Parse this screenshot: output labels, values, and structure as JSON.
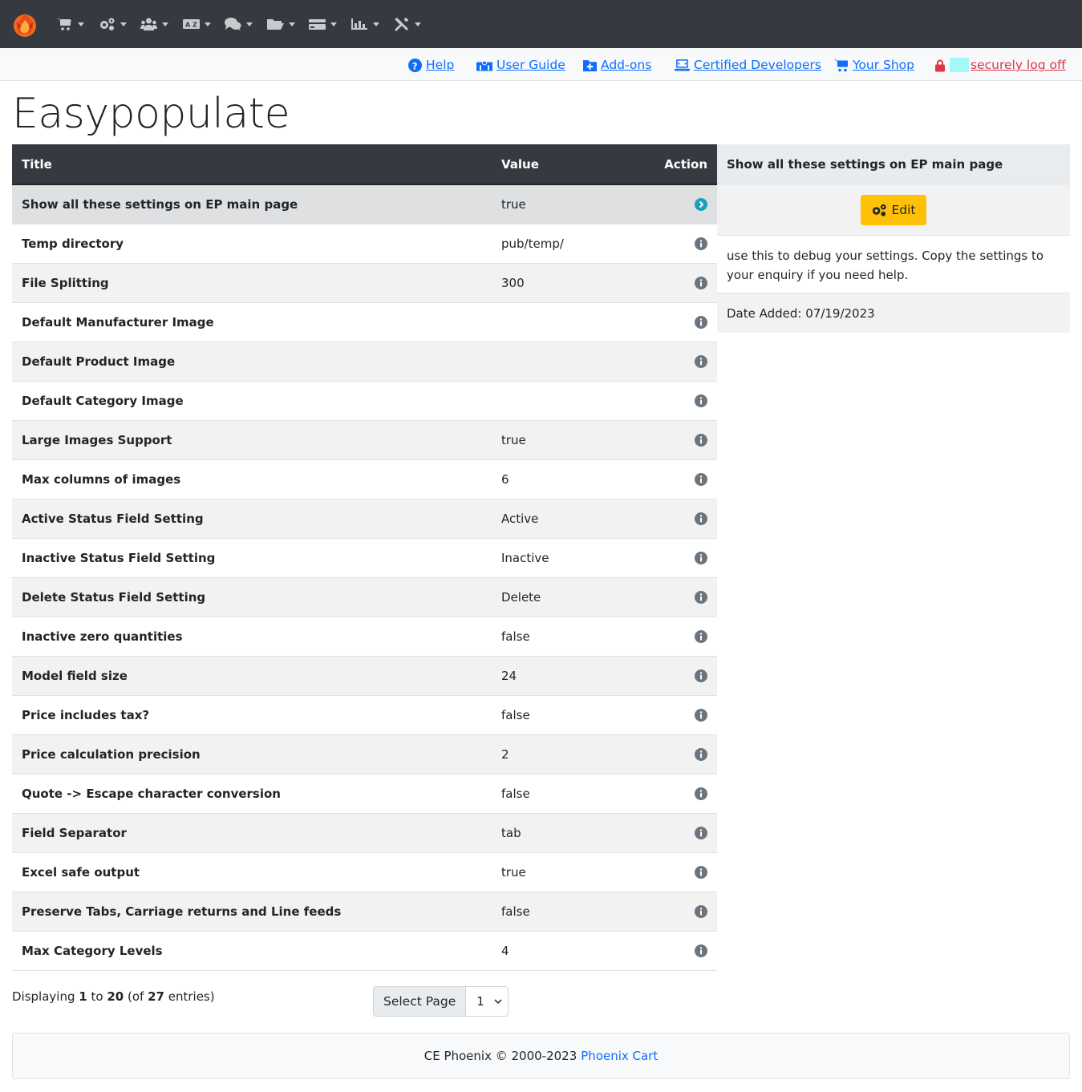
{
  "navbar": {
    "menus": [
      {
        "icon": "cart-icon"
      },
      {
        "icon": "cogs-icon"
      },
      {
        "icon": "users-icon"
      },
      {
        "icon": "language-icon"
      },
      {
        "icon": "comments-icon"
      },
      {
        "icon": "folder-icon"
      },
      {
        "icon": "payment-icon"
      },
      {
        "icon": "chart-icon"
      },
      {
        "icon": "tools-icon"
      }
    ]
  },
  "links": {
    "help": "Help",
    "user_guide": "User Guide",
    "addons": "Add-ons",
    "certified": "Certified Developers",
    "shop": "Your Shop",
    "logoff": "securely log off"
  },
  "page_title": "Easypopulate",
  "table": {
    "headers": {
      "title": "Title",
      "value": "Value",
      "action": "Action"
    },
    "rows": [
      {
        "title": "Show all these settings on EP main page",
        "value": "true"
      },
      {
        "title": "Temp directory",
        "value": "pub/temp/"
      },
      {
        "title": "File Splitting",
        "value": "300"
      },
      {
        "title": "Default Manufacturer Image",
        "value": ""
      },
      {
        "title": "Default Product Image",
        "value": ""
      },
      {
        "title": "Default Category Image",
        "value": ""
      },
      {
        "title": "Large Images Support",
        "value": "true"
      },
      {
        "title": "Max columns of images",
        "value": "6"
      },
      {
        "title": "Active Status Field Setting",
        "value": "Active"
      },
      {
        "title": "Inactive Status Field Setting",
        "value": "Inactive"
      },
      {
        "title": "Delete Status Field Setting",
        "value": "Delete"
      },
      {
        "title": "Inactive zero quantities",
        "value": "false"
      },
      {
        "title": "Model field size",
        "value": "24"
      },
      {
        "title": "Price includes tax?",
        "value": "false"
      },
      {
        "title": "Price calculation precision",
        "value": "2"
      },
      {
        "title": "Quote -> Escape character conversion",
        "value": "false"
      },
      {
        "title": "Field Separator",
        "value": "tab"
      },
      {
        "title": "Excel safe output",
        "value": "true"
      },
      {
        "title": "Preserve Tabs, Carriage returns and Line feeds",
        "value": "false"
      },
      {
        "title": "Max Category Levels",
        "value": "4"
      }
    ]
  },
  "side": {
    "heading": "Show all these settings on EP main page",
    "edit_label": "Edit",
    "description": "use this to debug your settings. Copy the settings to your enquiry if you need help.",
    "date_added": "Date Added: 07/19/2023"
  },
  "pagination": {
    "displaying": "Displaying",
    "from": "1",
    "to_word": "to",
    "to": "20",
    "of_open": "(of",
    "total": "27",
    "entries": "entries)",
    "select_label": "Select Page",
    "selected_page": "1"
  },
  "footer": {
    "text": "CE Phoenix © 2000-2023",
    "link": "Phoenix Cart"
  },
  "colors": {
    "navbar": "#343a40",
    "link": "#0d6efd",
    "danger": "#dc3545",
    "warning": "#ffc107",
    "info": "#17a2b8"
  }
}
